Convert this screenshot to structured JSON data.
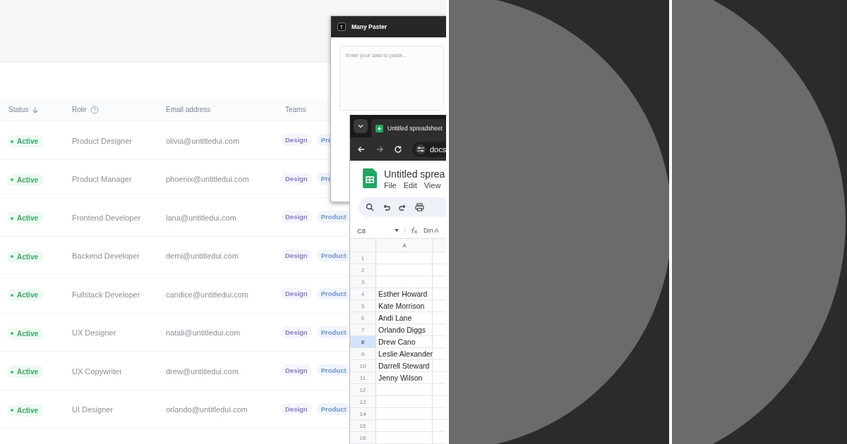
{
  "table": {
    "columns": [
      {
        "label": "Status",
        "kind": "sort"
      },
      {
        "label": "Role",
        "kind": "help"
      },
      {
        "label": "Email address",
        "kind": "plain"
      },
      {
        "label": "Teams",
        "kind": "plain"
      }
    ],
    "rows": [
      {
        "status": "Active",
        "role": "Product Designer",
        "email": "olivia@untitledui.com",
        "teams": [
          "Design",
          "Pro"
        ]
      },
      {
        "status": "Active",
        "role": "Product Manager",
        "email": "phoenix@untitledui.com",
        "teams": [
          "Design",
          "Pro"
        ]
      },
      {
        "status": "Active",
        "role": "Frontend Developer",
        "email": "lana@untitledui.com",
        "teams": [
          "Design",
          "Product"
        ]
      },
      {
        "status": "Active",
        "role": "Backend Developer",
        "email": "demi@untitledui.com",
        "teams": [
          "Design",
          "Product"
        ]
      },
      {
        "status": "Active",
        "role": "Fullstack Developer",
        "email": "candice@untitledui.com",
        "teams": [
          "Design",
          "Product"
        ]
      },
      {
        "status": "Active",
        "role": "UX Designer",
        "email": "natali@untitledui.com",
        "teams": [
          "Design",
          "Product"
        ]
      },
      {
        "status": "Active",
        "role": "UX Copywriter",
        "email": "drew@untitledui.com",
        "teams": [
          "Design",
          "Product"
        ]
      },
      {
        "status": "Active",
        "role": "UI Designer",
        "email": "orlando@untitledui.com",
        "teams": [
          "Design",
          "Product"
        ]
      }
    ]
  },
  "paster_window": {
    "logo_letter": "T",
    "title": "Many Paster",
    "placeholder": "Enter your data to paste..."
  },
  "browser_window": {
    "tab": "Untitled spreadsheet",
    "address": "docs",
    "doc_title": "Untitled sprea",
    "menu": [
      "File",
      "Edit",
      "View"
    ],
    "name_box": "C8",
    "formula": "Din A",
    "column": "A",
    "rows": [
      {
        "number": "1",
        "value": "",
        "selected": false
      },
      {
        "number": "2",
        "value": "",
        "selected": false
      },
      {
        "number": "3",
        "value": "",
        "selected": false
      },
      {
        "number": "4",
        "value": "Esther Howard",
        "selected": false
      },
      {
        "number": "5",
        "value": "Kate Morrison",
        "selected": false
      },
      {
        "number": "6",
        "value": "Andi Lane",
        "selected": false
      },
      {
        "number": "7",
        "value": "Orlando Diggs",
        "selected": false
      },
      {
        "number": "8",
        "value": "Drew Cano",
        "selected": true
      },
      {
        "number": "9",
        "value": "Leslie Alexander",
        "selected": false
      },
      {
        "number": "10",
        "value": "Darrell Steward",
        "selected": false
      },
      {
        "number": "11",
        "value": "Jenny Wilson",
        "selected": false
      },
      {
        "number": "12",
        "value": "",
        "selected": false
      },
      {
        "number": "13",
        "value": "",
        "selected": false
      },
      {
        "number": "14",
        "value": "",
        "selected": false
      },
      {
        "number": "15",
        "value": "",
        "selected": false
      },
      {
        "number": "16",
        "value": "",
        "selected": false
      }
    ]
  }
}
